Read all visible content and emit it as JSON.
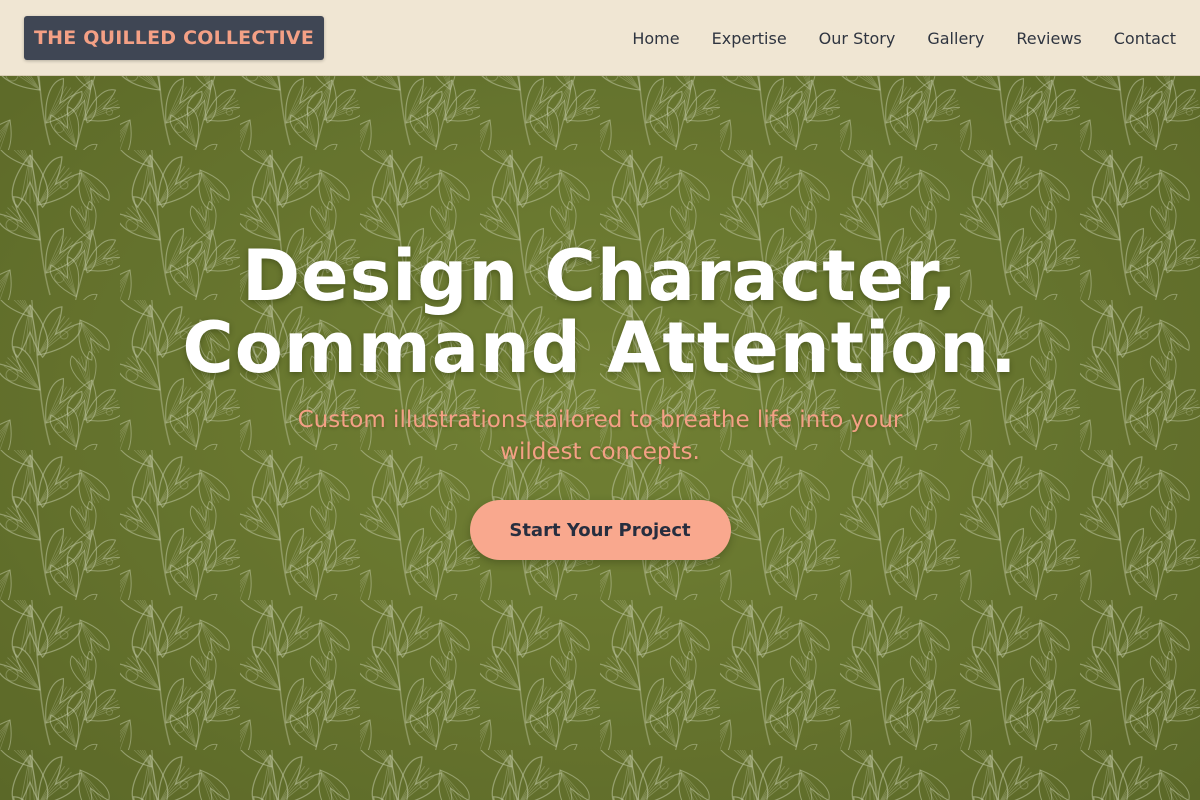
{
  "brand": {
    "name": "THE QUILLED COLLECTIVE",
    "accent_color": "#f4a085",
    "badge_color": "#3f4654"
  },
  "nav": {
    "background_color": "#f0e6d3",
    "items": [
      {
        "label": "Home"
      },
      {
        "label": "Expertise"
      },
      {
        "label": "Our Story"
      },
      {
        "label": "Gallery"
      },
      {
        "label": "Reviews"
      },
      {
        "label": "Contact"
      }
    ]
  },
  "hero": {
    "background_pattern": "ginkgo-leaf-pattern",
    "background_color": "#6d7c33",
    "title_line1": "Design Character,",
    "title_line2": "Command Attention.",
    "subtitle": "Custom illustrations tailored to breathe life into your wildest concepts.",
    "cta_label": "Start Your Project",
    "cta_color": "#f9a88e"
  }
}
